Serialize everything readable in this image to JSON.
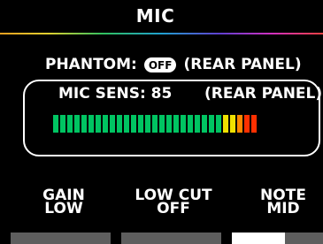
{
  "header": {
    "title": "MIC"
  },
  "phantom": {
    "label": "PHANTOM:",
    "state": "OFF",
    "location": "(REAR PANEL)"
  },
  "mic_sens": {
    "label": "MIC SENS: 85",
    "location": "(REAR PANEL)",
    "meter": {
      "lit_segments": 29,
      "colors": {
        "green": "#00c462",
        "yellow": "#f0e000",
        "orange": "#ff8800",
        "red": "#ff3000"
      },
      "segment_colors": [
        "green",
        "green",
        "green",
        "green",
        "green",
        "green",
        "green",
        "green",
        "green",
        "green",
        "green",
        "green",
        "green",
        "green",
        "green",
        "green",
        "green",
        "green",
        "green",
        "green",
        "green",
        "green",
        "green",
        "green",
        "yellow",
        "yellow",
        "orange",
        "red",
        "red"
      ]
    }
  },
  "softkeys": [
    {
      "line1": "GAIN",
      "line2": "LOW"
    },
    {
      "line1": "LOW CUT",
      "line2": "OFF"
    },
    {
      "line1": "NOTE",
      "line2": "MID"
    }
  ],
  "colors": {
    "background": "#000000",
    "text": "#ffffff",
    "tab": "#5e5e5e",
    "tab_active": "#ffffff"
  }
}
